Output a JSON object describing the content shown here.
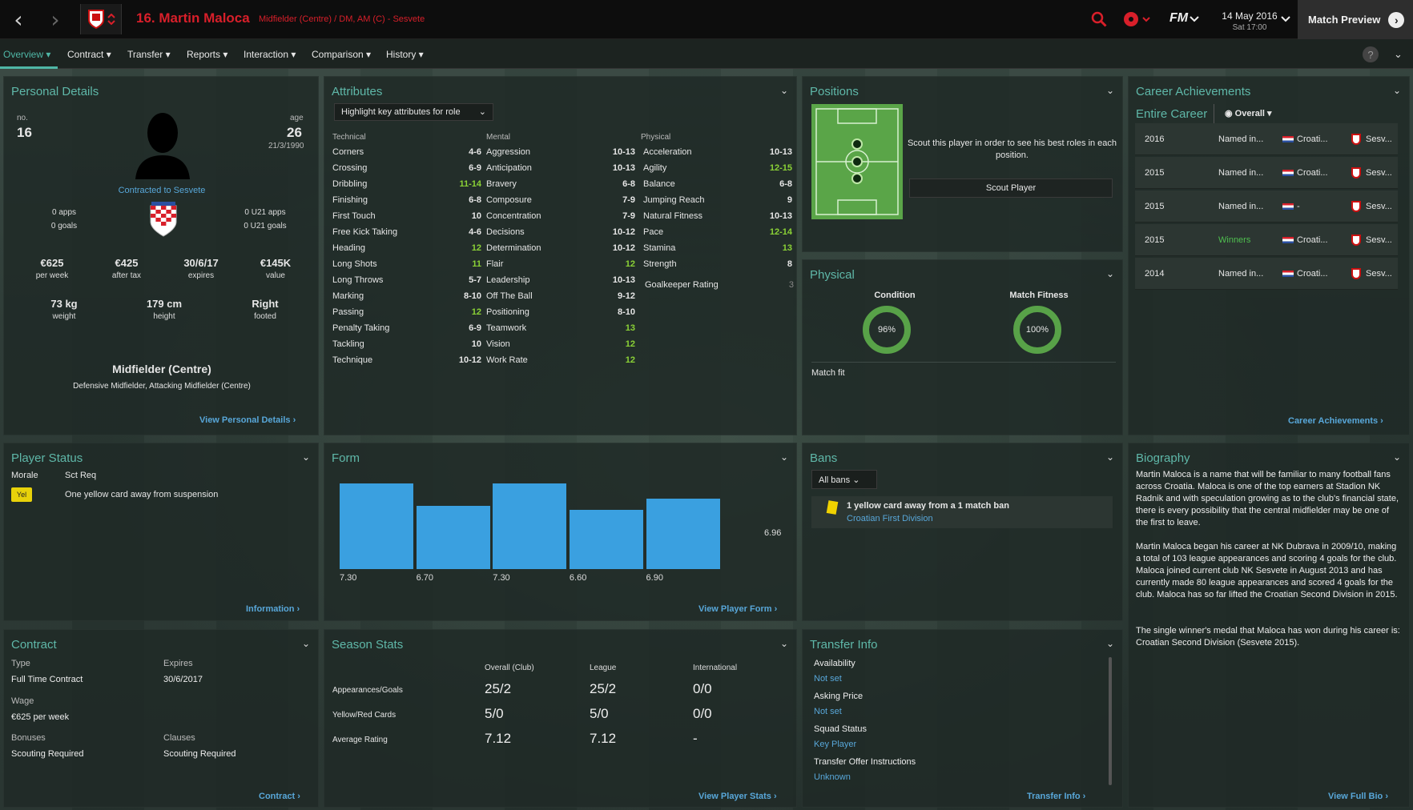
{
  "header": {
    "title": "16. Martin Maloca",
    "subtitle": "Midfielder (Centre) / DM, AM (C) - Sesvete",
    "date": "14 May 2016",
    "day": "Sat 17:00",
    "match_preview": "Match Preview",
    "logo": "FM"
  },
  "nav": {
    "tabs": [
      "Overview",
      "Contract",
      "Transfer",
      "Reports",
      "Interaction",
      "Comparison",
      "History"
    ]
  },
  "personal": {
    "title": "Personal Details",
    "no_label": "no.",
    "no": "16",
    "age_label": "age",
    "age": "26",
    "dob": "21/3/1990",
    "contracted": "Contracted to Sesvete",
    "apps": "0 apps",
    "goals": "0 goals",
    "u21apps": "0 U21 apps",
    "u21goals": "0 U21 goals",
    "stats": [
      {
        "v": "€625",
        "l": "per week"
      },
      {
        "v": "€425",
        "l": "after tax"
      },
      {
        "v": "30/6/17",
        "l": "expires"
      },
      {
        "v": "€145K",
        "l": "value"
      }
    ],
    "phys": [
      {
        "v": "73 kg",
        "l": "weight"
      },
      {
        "v": "179 cm",
        "l": "height"
      },
      {
        "v": "Right",
        "l": "footed"
      }
    ],
    "position": "Midfielder (Centre)",
    "positions": "Defensive Midfielder, Attacking Midfielder (Centre)",
    "link": "View Personal Details"
  },
  "attributes": {
    "title": "Attributes",
    "dropdown": "Highlight key attributes for role",
    "col_titles": [
      "Technical",
      "Mental",
      "Physical"
    ],
    "technical": [
      [
        "Corners",
        "4-6",
        0
      ],
      [
        "Crossing",
        "6-9",
        0
      ],
      [
        "Dribbling",
        "11-14",
        1
      ],
      [
        "Finishing",
        "6-8",
        0
      ],
      [
        "First Touch",
        "10",
        0
      ],
      [
        "Free Kick Taking",
        "4-6",
        0
      ],
      [
        "Heading",
        "12",
        1
      ],
      [
        "Long Shots",
        "11",
        1
      ],
      [
        "Long Throws",
        "5-7",
        0
      ],
      [
        "Marking",
        "8-10",
        0
      ],
      [
        "Passing",
        "12",
        1
      ],
      [
        "Penalty Taking",
        "6-9",
        0
      ],
      [
        "Tackling",
        "10",
        0
      ],
      [
        "Technique",
        "10-12",
        0
      ]
    ],
    "mental": [
      [
        "Aggression",
        "10-13",
        0
      ],
      [
        "Anticipation",
        "10-13",
        0
      ],
      [
        "Bravery",
        "6-8",
        0
      ],
      [
        "Composure",
        "7-9",
        0
      ],
      [
        "Concentration",
        "7-9",
        0
      ],
      [
        "Decisions",
        "10-12",
        0
      ],
      [
        "Determination",
        "10-12",
        0
      ],
      [
        "Flair",
        "12",
        1
      ],
      [
        "Leadership",
        "10-13",
        0
      ],
      [
        "Off The Ball",
        "9-12",
        0
      ],
      [
        "Positioning",
        "8-10",
        0
      ],
      [
        "Teamwork",
        "13",
        1
      ],
      [
        "Vision",
        "12",
        1
      ],
      [
        "Work Rate",
        "12",
        1
      ]
    ],
    "physical": [
      [
        "Acceleration",
        "10-13",
        0
      ],
      [
        "Agility",
        "12-15",
        1
      ],
      [
        "Balance",
        "6-8",
        0
      ],
      [
        "Jumping Reach",
        "9",
        0
      ],
      [
        "Natural Fitness",
        "10-13",
        0
      ],
      [
        "Pace",
        "12-14",
        1
      ],
      [
        "Stamina",
        "13",
        1
      ],
      [
        "Strength",
        "8",
        0
      ]
    ],
    "gk": [
      "Goalkeeper Rating",
      "3"
    ]
  },
  "positions": {
    "title": "Positions",
    "scout_text": "Scout this player in order to see his best roles in each position.",
    "scout_btn": "Scout Player"
  },
  "physical": {
    "title": "Physical",
    "condition_label": "Condition",
    "condition": "96%",
    "fitness_label": "Match Fitness",
    "fitness": "100%",
    "status": "Match fit"
  },
  "career": {
    "title": "Career Achievements",
    "subtitle": "Entire Career",
    "dropdown": "Overall",
    "link": "Career Achievements",
    "rows": [
      [
        "2016",
        "Named in...",
        "Croati...",
        "Sesv..."
      ],
      [
        "2015",
        "Named in...",
        "Croati...",
        "Sesv..."
      ],
      [
        "2015",
        "Named in...",
        "-",
        "Sesv..."
      ],
      [
        "2015",
        "Winners",
        "Croati...",
        "Sesv..."
      ],
      [
        "2014",
        "Named in...",
        "Croati...",
        "Sesv..."
      ]
    ]
  },
  "status": {
    "title": "Player Status",
    "morale": "Morale",
    "sctreq": "Sct Req",
    "badge": "Yel",
    "text": "One yellow card away from suspension",
    "link": "Information"
  },
  "form": {
    "title": "Form",
    "link": "View Player Form",
    "avg": "6.96",
    "values": [
      7.3,
      6.7,
      7.3,
      6.6,
      6.9
    ],
    "labels": [
      "7.30",
      "6.70",
      "7.30",
      "6.60",
      "6.90"
    ]
  },
  "bans": {
    "title": "Bans",
    "dropdown": "All bans",
    "text": "1 yellow card away from a 1 match ban",
    "comp": "Croatian First Division"
  },
  "bio": {
    "title": "Biography",
    "link": "View Full Bio",
    "p1": "Martin Maloca is a name that will be familiar to many football fans across Croatia. Maloca is one of the top earners at Stadion NK Radnik and with speculation growing as to the club's financial state, there is every possibility that the central midfielder may be one of the first to leave.",
    "p2": "Martin Maloca began his career at NK Dubrava in 2009/10, making a total of 103 league appearances and scoring 4 goals for the club. Maloca joined current club NK Sesvete in August 2013 and has currently made 80 league appearances and scored 4 goals for the club. Maloca has so far lifted the Croatian Second Division in 2015.",
    "p3": "The single winner's medal that Maloca has won during his career is: Croatian Second Division (Sesvete 2015)."
  },
  "contract": {
    "title": "Contract",
    "type_l": "Type",
    "type": "Full Time Contract",
    "exp_l": "Expires",
    "exp": "30/6/2017",
    "wage_l": "Wage",
    "wage": "€625 per week",
    "bon_l": "Bonuses",
    "bon": "Scouting Required",
    "cl_l": "Clauses",
    "cl": "Scouting Required",
    "link": "Contract"
  },
  "season": {
    "title": "Season Stats",
    "cols": [
      "Overall (Club)",
      "League",
      "International"
    ],
    "rows": [
      [
        "Appearances/Goals",
        "25/2",
        "25/2",
        "0/0"
      ],
      [
        "Yellow/Red Cards",
        "5/0",
        "5/0",
        "0/0"
      ],
      [
        "Average Rating",
        "7.12",
        "7.12",
        "-"
      ]
    ],
    "link": "View Player Stats"
  },
  "transfer": {
    "title": "Transfer Info",
    "items": [
      [
        "Availability",
        "Not set"
      ],
      [
        "Asking Price",
        "Not set"
      ],
      [
        "Squad Status",
        "Key Player"
      ],
      [
        "Transfer Offer Instructions",
        "Unknown"
      ]
    ],
    "link": "Transfer Info"
  },
  "colors": {
    "accent": "#5fb8a9",
    "link": "#58a7d9",
    "green": "#8bd236",
    "red": "#d81f2a",
    "bar": "#3aa0e0"
  }
}
